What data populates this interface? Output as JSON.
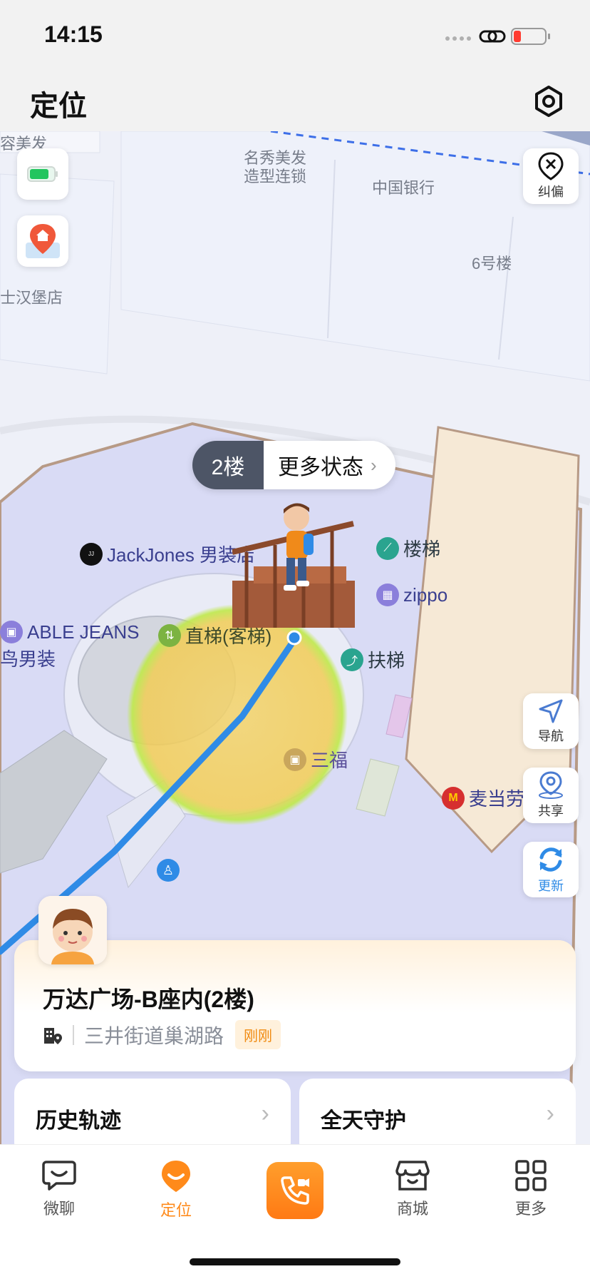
{
  "status_bar": {
    "time": "14:15"
  },
  "header": {
    "title": "定位"
  },
  "map": {
    "labels": {
      "beauty_left": "容美发",
      "mingxiu": "名秀美发",
      "mingxiu2": "造型连锁",
      "bank": "中国银行",
      "building6": "6号楼",
      "burger": "士汉堡店"
    },
    "pois": {
      "jackjones": "JackJones 男装店",
      "stairs": "楼梯",
      "zippo": "zippo",
      "able": "ABLE JEANS",
      "bird": "鸟男装",
      "elevator": "直梯(客梯)",
      "escalator": "扶梯",
      "sanfu": "三福",
      "mcd": "麦当劳"
    },
    "floor_popup": {
      "floor": "2楼",
      "more": "更多状态"
    },
    "buttons": {
      "correct": "纠偏",
      "navigate": "导航",
      "share": "共享",
      "refresh": "更新"
    }
  },
  "location_card": {
    "title": "万达广场-B座内(2楼)",
    "address": "三井街道巢湖路",
    "time_badge": "刚刚"
  },
  "features": {
    "history": "历史轨迹",
    "guard": "全天守护"
  },
  "tabbar": {
    "chat": "微聊",
    "location": "定位",
    "mall": "商城",
    "more": "更多"
  },
  "colors": {
    "accent": "#ff8a1a",
    "track": "#2f8be6",
    "mall": "#d7d9f5"
  }
}
